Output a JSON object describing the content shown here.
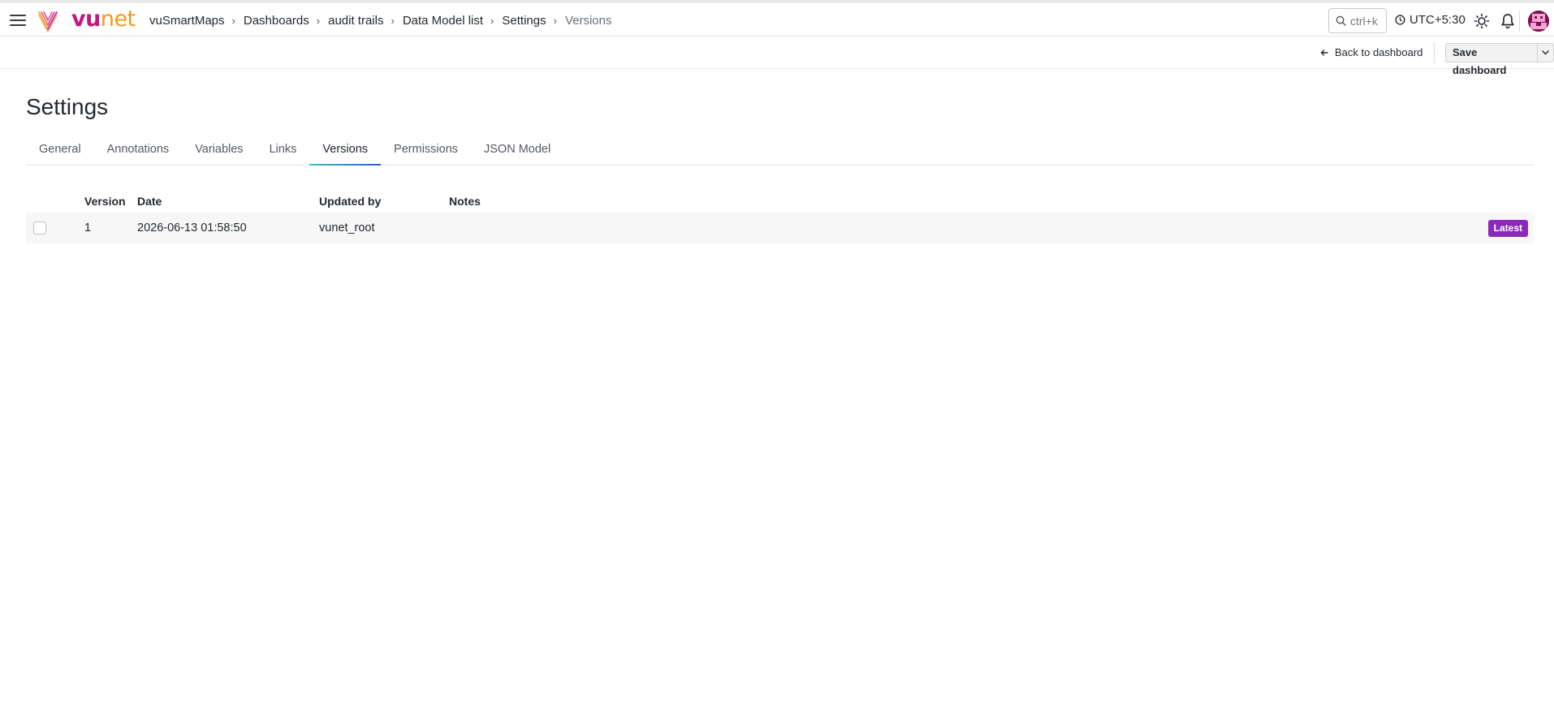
{
  "header": {
    "logo": {
      "vu": "vu",
      "net": "net"
    },
    "breadcrumb": [
      "vuSmartMaps",
      "Dashboards",
      "audit trails",
      "Data Model list",
      "Settings",
      "Versions"
    ],
    "search_placeholder": "ctrl+k",
    "timezone": "UTC+5:30",
    "icons": [
      "menu-icon",
      "search-icon",
      "clock-icon",
      "sun-icon",
      "bell-icon",
      "avatar"
    ]
  },
  "toolbar": {
    "back_label": "Back to dashboard",
    "save_label": "Save dashboard"
  },
  "page": {
    "title": "Settings"
  },
  "tabs": [
    {
      "label": "General",
      "active": false
    },
    {
      "label": "Annotations",
      "active": false
    },
    {
      "label": "Variables",
      "active": false
    },
    {
      "label": "Links",
      "active": false
    },
    {
      "label": "Versions",
      "active": true
    },
    {
      "label": "Permissions",
      "active": false
    },
    {
      "label": "JSON Model",
      "active": false
    }
  ],
  "versions": {
    "columns": [
      "Version",
      "Date",
      "Updated by",
      "Notes"
    ],
    "rows": [
      {
        "version": "1",
        "date": "2026-06-13 01:58:50",
        "updated_by": "vunet_root",
        "notes": "",
        "badge": "Latest",
        "checked": false
      }
    ]
  },
  "colors": {
    "brand_magenta": "#c51582",
    "brand_orange": "#f29a1c",
    "badge_purple": "#8b2ab8",
    "tab_underline_start": "#36c2c0",
    "tab_underline_end": "#2a5ad9"
  }
}
